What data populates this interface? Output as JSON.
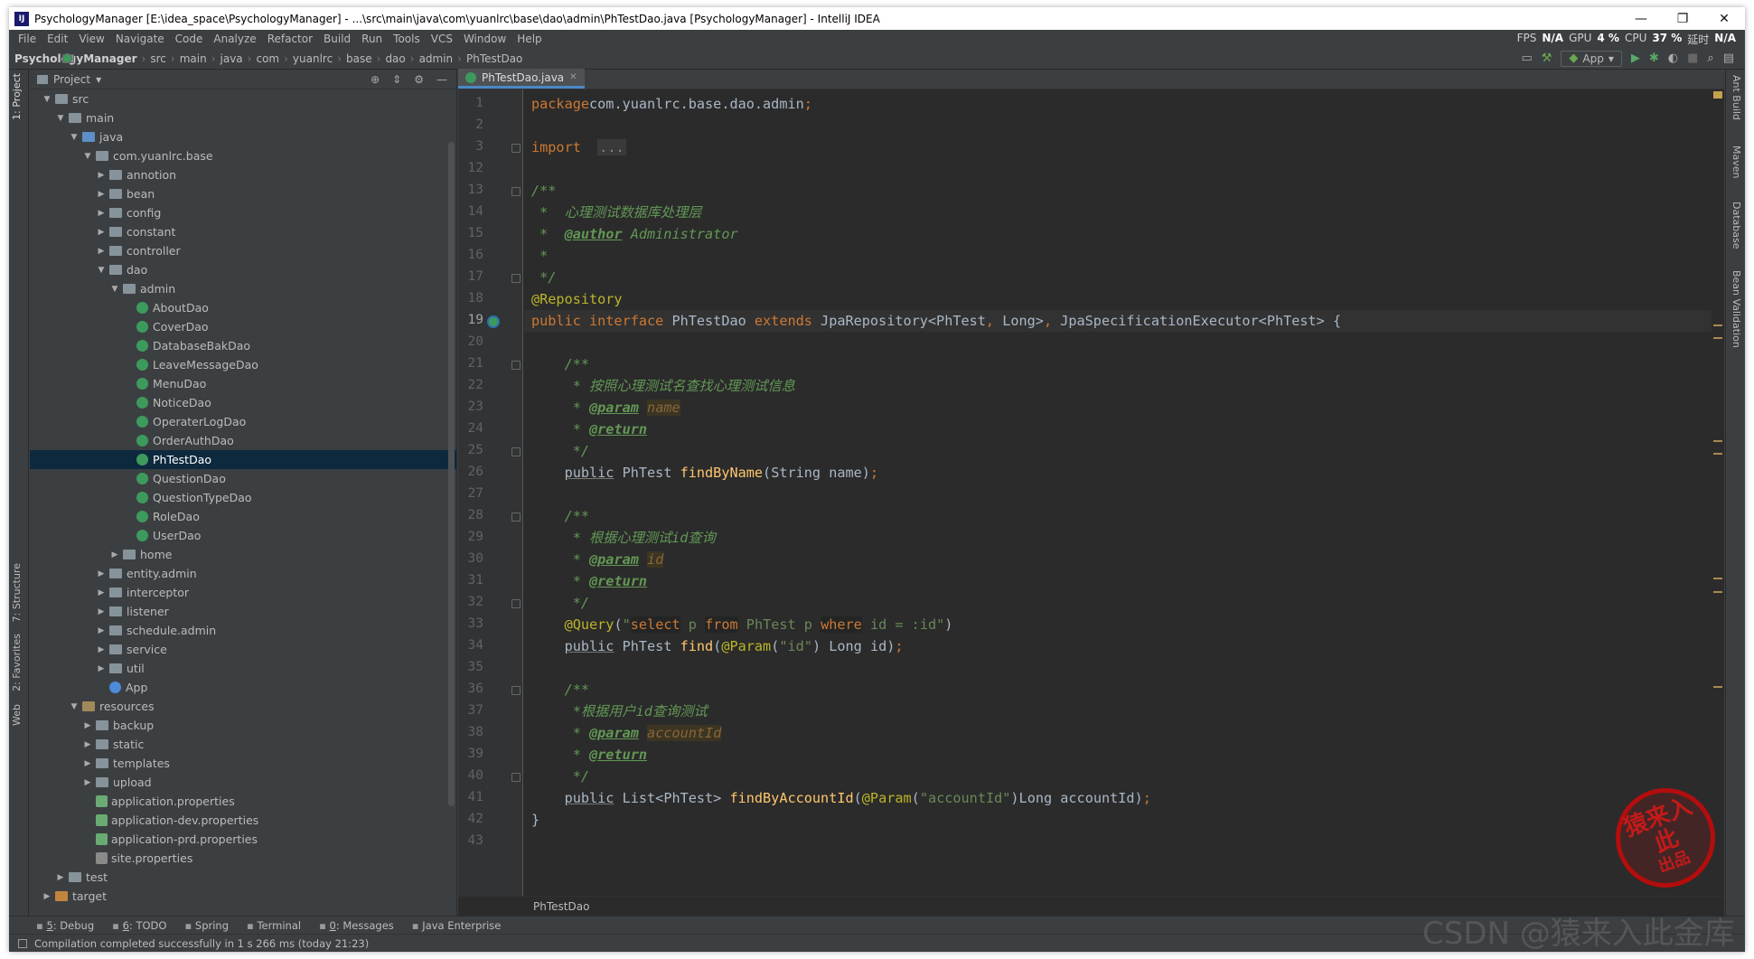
{
  "window": {
    "title": "PsychologyManager [E:\\idea_space\\PsychologyManager] - ...\\src\\main\\java\\com\\yuanlrc\\base\\dao\\admin\\PhTestDao.java [PsychologyManager] - IntelliJ IDEA",
    "app_icon": "IJ",
    "minimize": "—",
    "restore": "❐",
    "close": "✕"
  },
  "menu": {
    "items": [
      "File",
      "Edit",
      "View",
      "Navigate",
      "Code",
      "Analyze",
      "Refactor",
      "Build",
      "Run",
      "Tools",
      "VCS",
      "Window",
      "Help"
    ],
    "perf": {
      "fps_label": "FPS",
      "fps_value": "N/A",
      "gpu_label": "GPU",
      "gpu_value": "4 %",
      "cpu_label": "CPU",
      "cpu_value": "37 %",
      "lat_label": "延时",
      "lat_value": "N/A"
    }
  },
  "breadcrumb": [
    "PsychologyManager",
    "src",
    "main",
    "java",
    "com",
    "yuanlrc",
    "base",
    "dao",
    "admin",
    "PhTestDao"
  ],
  "run_config": "App",
  "project": {
    "header": "Project",
    "tree": [
      {
        "label": "src",
        "depth": 1,
        "arrow": "▼",
        "icon": "folder"
      },
      {
        "label": "main",
        "depth": 2,
        "arrow": "▼",
        "icon": "folder"
      },
      {
        "label": "java",
        "depth": 3,
        "arrow": "▼",
        "icon": "src"
      },
      {
        "label": "com.yuanlrc.base",
        "depth": 4,
        "arrow": "▼",
        "icon": "folder"
      },
      {
        "label": "annotion",
        "depth": 5,
        "arrow": "▶",
        "icon": "folder"
      },
      {
        "label": "bean",
        "depth": 5,
        "arrow": "▶",
        "icon": "folder"
      },
      {
        "label": "config",
        "depth": 5,
        "arrow": "▶",
        "icon": "folder"
      },
      {
        "label": "constant",
        "depth": 5,
        "arrow": "▶",
        "icon": "folder"
      },
      {
        "label": "controller",
        "depth": 5,
        "arrow": "▶",
        "icon": "folder"
      },
      {
        "label": "dao",
        "depth": 5,
        "arrow": "▼",
        "icon": "folder"
      },
      {
        "label": "admin",
        "depth": 6,
        "arrow": "▼",
        "icon": "folder"
      },
      {
        "label": "AboutDao",
        "depth": 7,
        "arrow": "",
        "icon": "class"
      },
      {
        "label": "CoverDao",
        "depth": 7,
        "arrow": "",
        "icon": "class"
      },
      {
        "label": "DatabaseBakDao",
        "depth": 7,
        "arrow": "",
        "icon": "class"
      },
      {
        "label": "LeaveMessageDao",
        "depth": 7,
        "arrow": "",
        "icon": "class"
      },
      {
        "label": "MenuDao",
        "depth": 7,
        "arrow": "",
        "icon": "class"
      },
      {
        "label": "NoticeDao",
        "depth": 7,
        "arrow": "",
        "icon": "class"
      },
      {
        "label": "OperaterLogDao",
        "depth": 7,
        "arrow": "",
        "icon": "class"
      },
      {
        "label": "OrderAuthDao",
        "depth": 7,
        "arrow": "",
        "icon": "class"
      },
      {
        "label": "PhTestDao",
        "depth": 7,
        "arrow": "",
        "icon": "class",
        "selected": true
      },
      {
        "label": "QuestionDao",
        "depth": 7,
        "arrow": "",
        "icon": "class"
      },
      {
        "label": "QuestionTypeDao",
        "depth": 7,
        "arrow": "",
        "icon": "class"
      },
      {
        "label": "RoleDao",
        "depth": 7,
        "arrow": "",
        "icon": "class"
      },
      {
        "label": "UserDao",
        "depth": 7,
        "arrow": "",
        "icon": "class"
      },
      {
        "label": "home",
        "depth": 6,
        "arrow": "▶",
        "icon": "folder"
      },
      {
        "label": "entity.admin",
        "depth": 5,
        "arrow": "▶",
        "icon": "folder"
      },
      {
        "label": "interceptor",
        "depth": 5,
        "arrow": "▶",
        "icon": "folder"
      },
      {
        "label": "listener",
        "depth": 5,
        "arrow": "▶",
        "icon": "folder"
      },
      {
        "label": "schedule.admin",
        "depth": 5,
        "arrow": "▶",
        "icon": "folder"
      },
      {
        "label": "service",
        "depth": 5,
        "arrow": "▶",
        "icon": "folder"
      },
      {
        "label": "util",
        "depth": 5,
        "arrow": "▶",
        "icon": "folder"
      },
      {
        "label": "App",
        "depth": 5,
        "arrow": "",
        "icon": "app"
      },
      {
        "label": "resources",
        "depth": 3,
        "arrow": "▼",
        "icon": "res"
      },
      {
        "label": "backup",
        "depth": 4,
        "arrow": "▶",
        "icon": "folder"
      },
      {
        "label": "static",
        "depth": 4,
        "arrow": "▶",
        "icon": "folder"
      },
      {
        "label": "templates",
        "depth": 4,
        "arrow": "▶",
        "icon": "folder"
      },
      {
        "label": "upload",
        "depth": 4,
        "arrow": "▶",
        "icon": "folder"
      },
      {
        "label": "application.properties",
        "depth": 4,
        "arrow": "",
        "icon": "prop"
      },
      {
        "label": "application-dev.properties",
        "depth": 4,
        "arrow": "",
        "icon": "prop"
      },
      {
        "label": "application-prd.properties",
        "depth": 4,
        "arrow": "",
        "icon": "prop"
      },
      {
        "label": "site.properties",
        "depth": 4,
        "arrow": "",
        "icon": "site"
      },
      {
        "label": "test",
        "depth": 2,
        "arrow": "▶",
        "icon": "folder"
      },
      {
        "label": "target",
        "depth": 1,
        "arrow": "▶",
        "icon": "tgt"
      }
    ]
  },
  "left_tools": [
    "1: Project",
    "7: Structure",
    "2: Favorites",
    "Web"
  ],
  "right_tools": [
    "Ant Build",
    "Maven",
    "Database",
    "Bean Validation"
  ],
  "editor": {
    "tab": "PhTestDao.java",
    "current_line": 19,
    "line_numbers": [
      1,
      2,
      3,
      12,
      13,
      14,
      15,
      16,
      17,
      18,
      19,
      20,
      21,
      22,
      23,
      24,
      25,
      26,
      27,
      28,
      29,
      30,
      31,
      32,
      33,
      34,
      35,
      36,
      37,
      38,
      39,
      40,
      41,
      42,
      43
    ],
    "lines": [
      [
        [
          "kw",
          "package"
        ],
        [
          "",
          "com.yuanlrc.base.dao.admin"
        ],
        [
          "kw",
          ";"
        ]
      ],
      [],
      [
        [
          "kw",
          "import"
        ],
        [
          "",
          "  "
        ],
        [
          "fbox",
          "..."
        ]
      ],
      [],
      [
        [
          "cm",
          "/**"
        ]
      ],
      [
        [
          "cm",
          " *  心理测试数据库处理层"
        ]
      ],
      [
        [
          "cm",
          " *  "
        ],
        [
          "tg",
          "@author"
        ],
        [
          "cm",
          " Administrator"
        ]
      ],
      [
        [
          "cm",
          " *"
        ]
      ],
      [
        [
          "cm",
          " */"
        ]
      ],
      [
        [
          "an",
          "@Repository"
        ]
      ],
      [
        [
          "kw",
          "public interface "
        ],
        [
          "",
          "PhTestDao "
        ],
        [
          "kw",
          "extends "
        ],
        [
          "",
          "JpaRepository<PhTest"
        ],
        [
          "kw",
          ", "
        ],
        [
          "",
          "Long>"
        ],
        [
          "kw",
          ", "
        ],
        [
          "",
          "JpaSpecificationExecutor<PhTest> {"
        ]
      ],
      [],
      [
        [
          "cm",
          "    /**"
        ]
      ],
      [
        [
          "cm",
          "     * 按照心理测试名查找心理测试信息"
        ]
      ],
      [
        [
          "cm",
          "     * "
        ],
        [
          "tg",
          "@param"
        ],
        [
          "cm",
          " "
        ],
        [
          "pr",
          "name"
        ]
      ],
      [
        [
          "cm",
          "     * "
        ],
        [
          "tg",
          "@return"
        ]
      ],
      [
        [
          "cm",
          "     */"
        ]
      ],
      [
        [
          "",
          "    "
        ],
        [
          "un",
          "public"
        ],
        [
          "",
          " PhTest "
        ],
        [
          "fn",
          "findByName"
        ],
        [
          "",
          "(String name)"
        ],
        [
          "kw",
          ";"
        ]
      ],
      [],
      [
        [
          "cm",
          "    /**"
        ]
      ],
      [
        [
          "cm",
          "     * 根据心理测试id查询"
        ]
      ],
      [
        [
          "cm",
          "     * "
        ],
        [
          "tg",
          "@param"
        ],
        [
          "cm",
          " "
        ],
        [
          "pr",
          "id"
        ]
      ],
      [
        [
          "cm",
          "     * "
        ],
        [
          "tg",
          "@return"
        ]
      ],
      [
        [
          "cm",
          "     */"
        ]
      ],
      [
        [
          "",
          "    "
        ],
        [
          "an",
          "@Query"
        ],
        [
          "",
          "("
        ],
        [
          "st",
          "\""
        ],
        [
          "sq",
          "select"
        ],
        [
          "st",
          " p "
        ],
        [
          "sq",
          "from"
        ],
        [
          "st",
          " PhTest p "
        ],
        [
          "sq",
          "where"
        ],
        [
          "st",
          " id = :id\""
        ],
        [
          "",
          ")"
        ]
      ],
      [
        [
          "",
          "    "
        ],
        [
          "un",
          "public"
        ],
        [
          "",
          " PhTest "
        ],
        [
          "fn",
          "find"
        ],
        [
          "",
          "("
        ],
        [
          "an",
          "@Param"
        ],
        [
          "",
          "("
        ],
        [
          "st",
          "\"id\""
        ],
        [
          "",
          ") Long id)"
        ],
        [
          "kw",
          ";"
        ]
      ],
      [],
      [
        [
          "cm",
          "    /**"
        ]
      ],
      [
        [
          "cm",
          "     *根据用户id查询测试"
        ]
      ],
      [
        [
          "cm",
          "     * "
        ],
        [
          "tg",
          "@param"
        ],
        [
          "cm",
          " "
        ],
        [
          "pr",
          "accountId"
        ]
      ],
      [
        [
          "cm",
          "     * "
        ],
        [
          "tg",
          "@return"
        ]
      ],
      [
        [
          "cm",
          "     */"
        ]
      ],
      [
        [
          "",
          "    "
        ],
        [
          "un",
          "public"
        ],
        [
          "",
          " List<PhTest> "
        ],
        [
          "fn",
          "findByAccountId"
        ],
        [
          "",
          "("
        ],
        [
          "an",
          "@Param"
        ],
        [
          "",
          "("
        ],
        [
          "st",
          "\"accountId\""
        ],
        [
          "",
          ")Long accountId)"
        ],
        [
          "kw",
          ";"
        ]
      ],
      [
        [
          "",
          "}"
        ]
      ],
      []
    ],
    "breadcrumb": "PhTestDao"
  },
  "bottom_tools": [
    {
      "icon": "bug-icon",
      "key": "5",
      "label": ": Debug"
    },
    {
      "icon": "todo-icon",
      "key": "6",
      "label": ": TODO"
    },
    {
      "icon": "spring-icon",
      "key": "",
      "label": "Spring"
    },
    {
      "icon": "terminal-icon",
      "key": "",
      "label": "Terminal"
    },
    {
      "icon": "messages-icon",
      "key": "0",
      "label": ": Messages"
    },
    {
      "icon": "java-enterprise-icon",
      "key": "",
      "label": "Java Enterprise"
    }
  ],
  "status": "Compilation completed successfully in 1 s 266 ms (today 21:23)",
  "watermark": {
    "seal_text": "猿来入此",
    "seal_small": "出品",
    "csdn": "CSDN @猿来入此金库"
  },
  "colors": {
    "bg": "#2b2b2b",
    "panel": "#3c3f41",
    "keyword": "#cc7832",
    "annotation": "#bbb529",
    "comment": "#629755",
    "string": "#6a8759",
    "function": "#ffc66d",
    "selection": "#0d293e",
    "seal": "#b40d0d"
  }
}
